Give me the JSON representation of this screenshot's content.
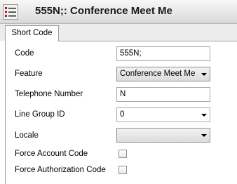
{
  "window": {
    "title": "555N;: Conference Meet Me",
    "icon": "list-icon"
  },
  "tabs": [
    {
      "label": "Short Code",
      "active": true
    }
  ],
  "form": {
    "code": {
      "label": "Code",
      "value": "555N;"
    },
    "feature": {
      "label": "Feature",
      "value": "Conference Meet Me"
    },
    "telephone_number": {
      "label": "Telephone Number",
      "value": "N"
    },
    "line_group_id": {
      "label": "Line Group ID",
      "value": "0"
    },
    "locale": {
      "label": "Locale",
      "value": ""
    },
    "force_account_code": {
      "label": "Force Account Code",
      "checked": false
    },
    "force_authorization_code": {
      "label": "Force Authorization Code",
      "checked": false
    }
  }
}
